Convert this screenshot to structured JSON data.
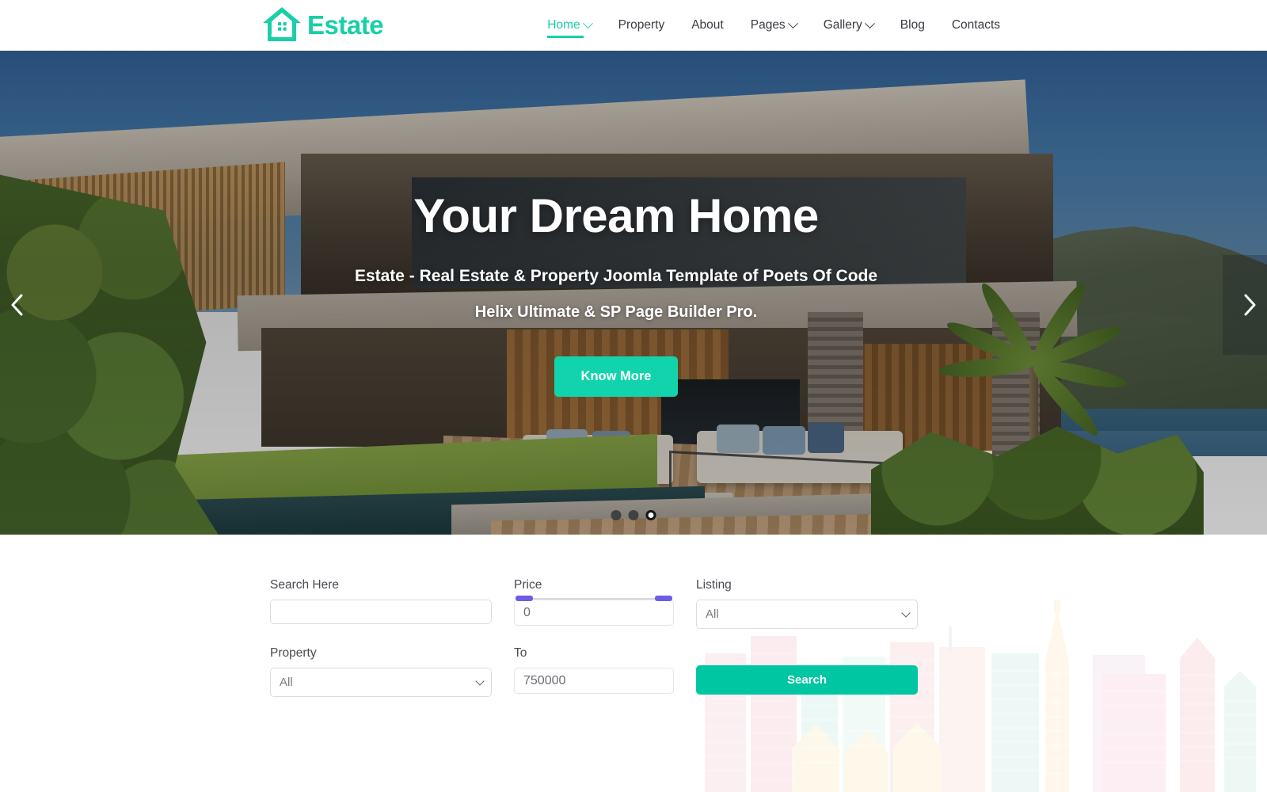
{
  "site": {
    "brand_name": "Estate",
    "brand_icon": "house-chat-icon"
  },
  "nav": {
    "items": [
      {
        "label": "Home",
        "icon": "chevron-down-icon",
        "has_dropdown": true,
        "active": true
      },
      {
        "label": "Property",
        "icon": "",
        "has_dropdown": false,
        "active": false
      },
      {
        "label": "About",
        "icon": "",
        "has_dropdown": false,
        "active": false
      },
      {
        "label": "Pages",
        "icon": "chevron-down-icon",
        "has_dropdown": true,
        "active": false
      },
      {
        "label": "Gallery",
        "icon": "chevron-down-icon",
        "has_dropdown": true,
        "active": false
      },
      {
        "label": "Blog",
        "icon": "",
        "has_dropdown": false,
        "active": false
      },
      {
        "label": "Contacts",
        "icon": "",
        "has_dropdown": false,
        "active": false
      }
    ]
  },
  "hero": {
    "title": "Your Dream Home",
    "subtitle_line1": "Estate - Real Estate & Property Joomla Template of Poets Of Code",
    "subtitle_line2": "Helix Ultimate & SP Page Builder Pro.",
    "cta_label": "Know More",
    "prev_icon": "chevron-left-icon",
    "next_icon": "chevron-right-icon",
    "slide_count": 3,
    "active_slide": 3,
    "image_alt": "Modern luxury villa with infinity pool, outdoor terrace lounge, palm trees and mountain backdrop"
  },
  "search": {
    "search_here_label": "Search Here",
    "search_here_value": "",
    "search_here_placeholder": "",
    "property_label": "Property",
    "property_value": "All",
    "property_options": [
      "All"
    ],
    "price_label": "Price",
    "price_from_value": "0",
    "price_to_label": "To",
    "price_to_value": "750000",
    "slider_min_handle": "price-min-handle",
    "slider_max_handle": "price-max-handle",
    "listing_label": "Listing",
    "listing_value": "All",
    "listing_options": [
      "All"
    ],
    "submit_label": "Search"
  },
  "colors": {
    "brand_teal": "#18CFA8",
    "cta_teal": "#12D4AC",
    "search_teal": "#00C6A2",
    "slider_purple": "#6C5CE7",
    "text_dark": "#3b3b43"
  }
}
